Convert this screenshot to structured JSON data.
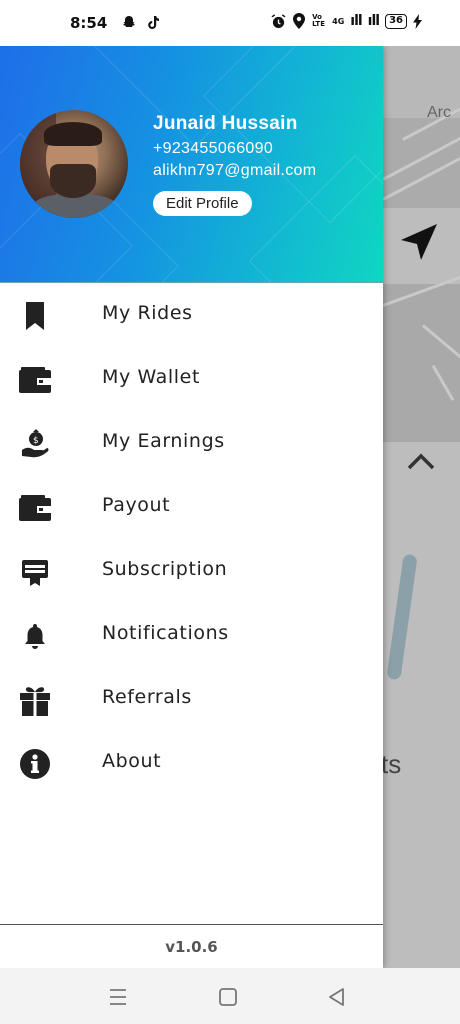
{
  "status_bar": {
    "time": "8:54",
    "battery": "36",
    "network_label": "Vo LTE",
    "data_label": "4G"
  },
  "profile": {
    "name": "Junaid Hussain",
    "phone": "+923455066090",
    "email": "alikhn797@gmail.com",
    "edit_button": "Edit Profile"
  },
  "menu": {
    "items": [
      {
        "label": "My Rides",
        "icon": "bookmark-icon"
      },
      {
        "label": "My Wallet",
        "icon": "wallet-icon"
      },
      {
        "label": "My Earnings",
        "icon": "money-hand-icon"
      },
      {
        "label": "Payout",
        "icon": "wallet-icon"
      },
      {
        "label": "Subscription",
        "icon": "card-badge-icon"
      },
      {
        "label": "Notifications",
        "icon": "bell-icon"
      },
      {
        "label": "Referrals",
        "icon": "gift-icon"
      },
      {
        "label": "About",
        "icon": "info-icon"
      }
    ]
  },
  "footer": {
    "version": "v1.0.6"
  },
  "map": {
    "partial_text_right": "ts",
    "partial_label_top": "Arc"
  },
  "colors": {
    "header_gradient_start": "#1f6ee8",
    "header_gradient_end": "#10d6c2",
    "icon_color": "#222222"
  }
}
